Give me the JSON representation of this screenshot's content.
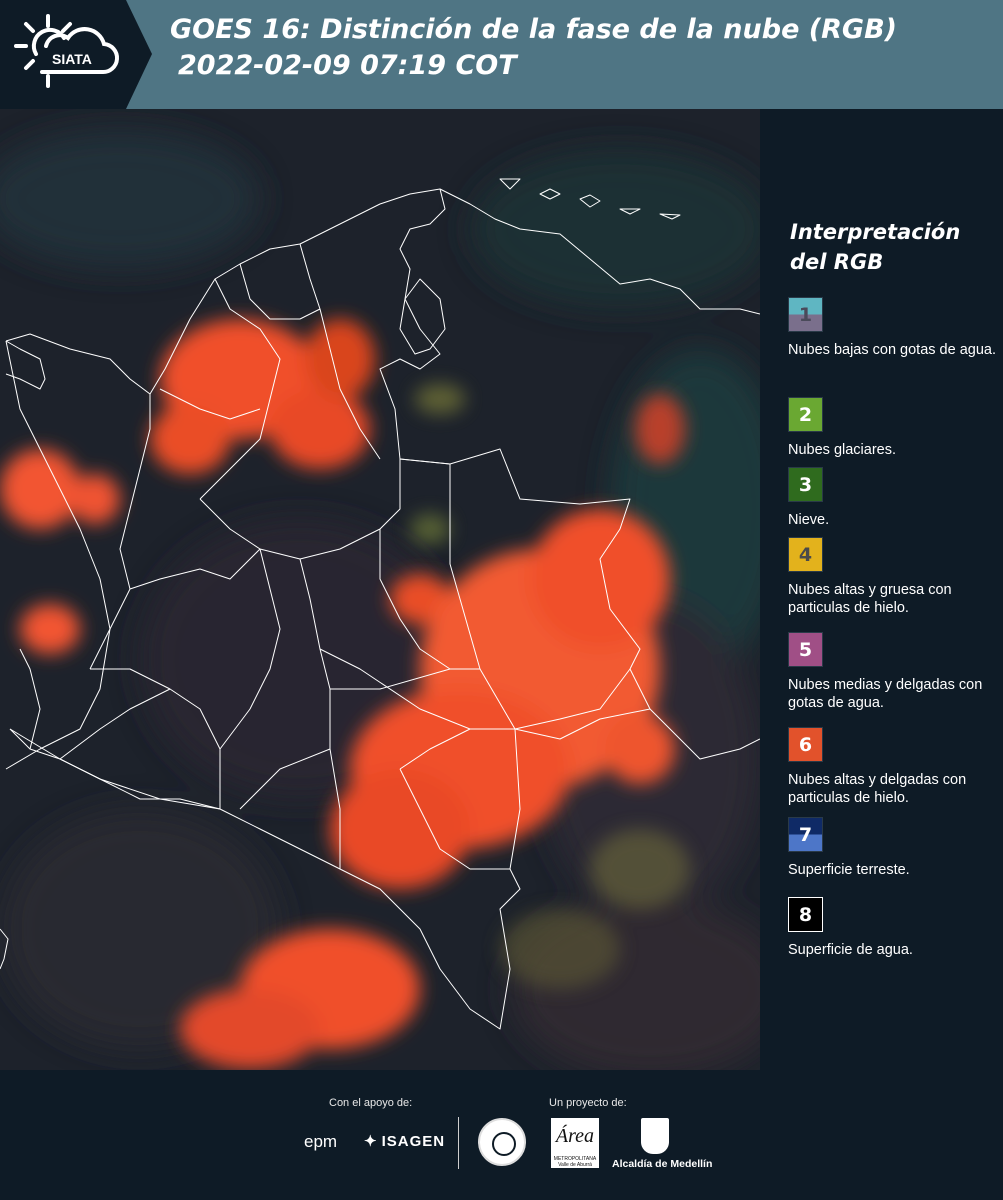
{
  "header": {
    "logo_text": "SIATA",
    "title_line1": "GOES 16: Distinción de la fase de la nube (RGB)",
    "title_line2": "2022-02-09 07:19 COT"
  },
  "legend": {
    "title_line1": "Interpretación",
    "title_line2": "del RGB",
    "items": [
      {
        "number": "1",
        "label": "Nubes bajas con gotas de agua.",
        "color_top": "#5fb6c2",
        "color_bottom": "#7a6f8c"
      },
      {
        "number": "2",
        "label": "Nubes glaciares.",
        "color_top": "#6aa832",
        "color_bottom": "#6aa832"
      },
      {
        "number": "3",
        "label": "Nieve.",
        "color_top": "#2f6b1e",
        "color_bottom": "#2f6b1e"
      },
      {
        "number": "4",
        "label": "Nubes altas y gruesa con particulas de hielo.",
        "color_top": "#e3b21c",
        "color_bottom": "#e3b21c"
      },
      {
        "number": "5",
        "label": "Nubes medias y delgadas con gotas de agua.",
        "color_top": "#a04f86",
        "color_bottom": "#a04f86"
      },
      {
        "number": "6",
        "label": "Nubes altas y delgadas con particulas de hielo.",
        "color_top": "#e2522b",
        "color_bottom": "#e2522b"
      },
      {
        "number": "7",
        "label": "Superficie terreste.",
        "color_top": "#0f2a66",
        "color_bottom": "#4d76c8"
      },
      {
        "number": "8",
        "label": "Superficie de agua.",
        "color_top": "#000000",
        "color_bottom": "#000000"
      }
    ]
  },
  "footer": {
    "support_label": "Con el apoyo de:",
    "project_label": "Un proyecto de:",
    "epm_text": "epm",
    "isagen_text": "ISAGEN",
    "area_text": "Área",
    "area_sub": "METROPOLITANA Valle de Aburrá",
    "alcaldia_text": "Alcaldía de Medellín"
  },
  "colors": {
    "header_bg": "#4f7584",
    "panel_bg": "#0e1b26",
    "cloud_orange": "#f0502a",
    "border_white": "#ffffff"
  }
}
